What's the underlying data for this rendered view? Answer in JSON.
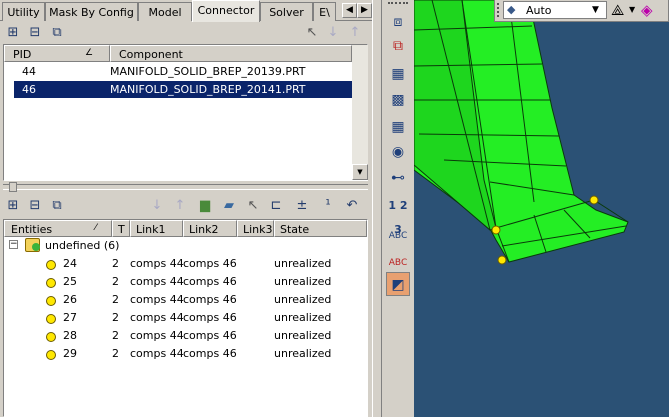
{
  "tabs": [
    {
      "label": "Utility",
      "active": false
    },
    {
      "label": "Mask By Config",
      "active": false
    },
    {
      "label": "Model",
      "active": false
    },
    {
      "label": "Connector",
      "active": true
    },
    {
      "label": "Solver",
      "active": false
    },
    {
      "label": "E\\",
      "active": false
    }
  ],
  "component_table": {
    "columns": [
      "PID",
      "Component"
    ],
    "rows": [
      {
        "pid": "44",
        "component": "MANIFOLD_SOLID_BREP_20139.PRT",
        "selected": false
      },
      {
        "pid": "46",
        "component": "MANIFOLD_SOLID_BREP_20141.PRT",
        "selected": true
      }
    ]
  },
  "entity_table": {
    "columns": [
      "Entities",
      "T",
      "Link1",
      "Link2",
      "Link3",
      "State"
    ],
    "group": {
      "label": "undefined (6)",
      "expand_symbol": "−"
    },
    "rows": [
      {
        "id": "24",
        "t": "2",
        "link1": "comps 44",
        "link2": "comps 46",
        "link3": "",
        "state": "unrealized"
      },
      {
        "id": "25",
        "t": "2",
        "link1": "comps 44",
        "link2": "comps 46",
        "link3": "",
        "state": "unrealized"
      },
      {
        "id": "26",
        "t": "2",
        "link1": "comps 44",
        "link2": "comps 46",
        "link3": "",
        "state": "unrealized"
      },
      {
        "id": "27",
        "t": "2",
        "link1": "comps 44",
        "link2": "comps 46",
        "link3": "",
        "state": "unrealized"
      },
      {
        "id": "28",
        "t": "2",
        "link1": "comps 44",
        "link2": "comps 46",
        "link3": "",
        "state": "unrealized"
      },
      {
        "id": "29",
        "t": "2",
        "link1": "comps 44",
        "link2": "comps 46",
        "link3": "",
        "state": "unrealized"
      }
    ]
  },
  "vertical_toolbar": {
    "numbered_label": "1 2 3",
    "abc_label": "ABC",
    "abc_label_2": "ABC"
  },
  "viewport_toolbar": {
    "view_mode": "Auto"
  },
  "colors": {
    "selection": "#0a246a",
    "mesh_green": "#22ee22",
    "viewport_bg": "#2b5175",
    "connector_yellow": "#ffe800"
  }
}
